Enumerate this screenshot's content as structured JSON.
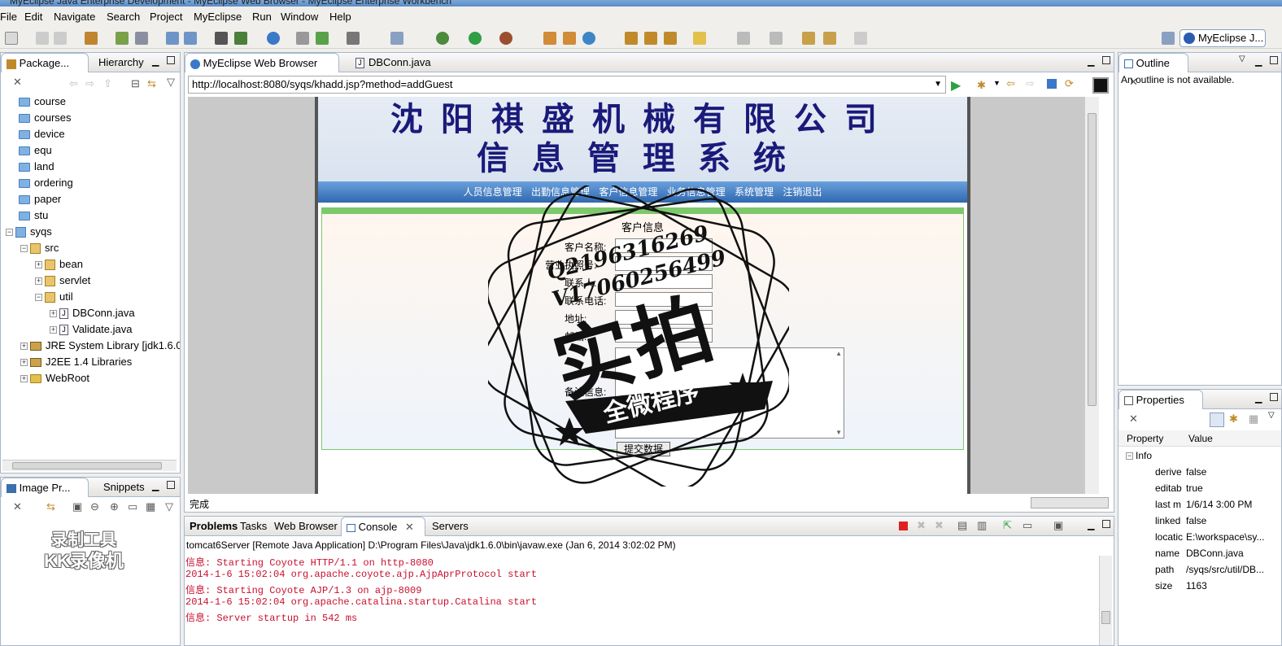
{
  "window": {
    "title": "MyEclipse Java Enterprise Development - MyEclipse Web Browser - MyEclipse Enterprise Workbench"
  },
  "menu": [
    "File",
    "Edit",
    "Navigate",
    "Search",
    "Project",
    "MyEclipse",
    "Run",
    "Window",
    "Help"
  ],
  "perspective": {
    "label": "MyEclipse J..."
  },
  "left_panel": {
    "tabs": [
      "Package...",
      "Hierarchy"
    ],
    "tree": [
      {
        "label": "course",
        "indent": 0,
        "kind": "folder"
      },
      {
        "label": "courses",
        "indent": 0,
        "kind": "folder"
      },
      {
        "label": "device",
        "indent": 0,
        "kind": "folder"
      },
      {
        "label": "equ",
        "indent": 0,
        "kind": "folder"
      },
      {
        "label": "land",
        "indent": 0,
        "kind": "folder"
      },
      {
        "label": "ordering",
        "indent": 0,
        "kind": "folder"
      },
      {
        "label": "paper",
        "indent": 0,
        "kind": "folder"
      },
      {
        "label": "stu",
        "indent": 0,
        "kind": "folder"
      },
      {
        "label": "syqs",
        "indent": 0,
        "kind": "project"
      },
      {
        "label": "src",
        "indent": 1,
        "kind": "pkg"
      },
      {
        "label": "bean",
        "indent": 2,
        "kind": "pkg"
      },
      {
        "label": "servlet",
        "indent": 2,
        "kind": "pkg"
      },
      {
        "label": "util",
        "indent": 2,
        "kind": "pkg"
      },
      {
        "label": "DBConn.java",
        "indent": 3,
        "kind": "java"
      },
      {
        "label": "Validate.java",
        "indent": 3,
        "kind": "java"
      },
      {
        "label": "JRE System Library [jdk1.6.0",
        "indent": 1,
        "kind": "lib"
      },
      {
        "label": "J2EE 1.4 Libraries",
        "indent": 1,
        "kind": "lib"
      },
      {
        "label": "WebRoot",
        "indent": 1,
        "kind": "folder"
      }
    ]
  },
  "image_panel": {
    "tabs": [
      "Image Pr...",
      "Snippets"
    ],
    "watermark": [
      "录制工具",
      "KK录像机"
    ]
  },
  "editor": {
    "tabs": [
      "MyEclipse Web Browser",
      "DBConn.java"
    ],
    "url": "http://localhost:8080/syqs/khadd.jsp?method=addGuest",
    "status": "完成"
  },
  "web": {
    "title_line1": "沈阳祺盛机械有限公司",
    "title_line2": "信息管理系统",
    "nav": [
      "人员信息管理",
      "出勤信息管理",
      "客户信息管理",
      "业务信息管理",
      "系统管理",
      "注销退出"
    ],
    "form_title": "客户信息",
    "labels": [
      "客户名称:",
      "营业执照号:",
      "联系人:",
      "联系电话:",
      "地址:",
      "邮编:",
      "备注信息:"
    ],
    "submit": "提交数据"
  },
  "stamp": {
    "qq": "Q2196316269",
    "v": "V17060256499",
    "big": "实拍",
    "banner": "全微程序"
  },
  "outline": {
    "tab": "Outline",
    "message": "An outline is not available."
  },
  "properties": {
    "tab": "Properties",
    "col_property": "Property",
    "col_value": "Value",
    "group": "Info",
    "rows": [
      {
        "k": "derive",
        "v": "false"
      },
      {
        "k": "editab",
        "v": "true"
      },
      {
        "k": "last m",
        "v": "1/6/14 3:00 PM"
      },
      {
        "k": "linked",
        "v": "false"
      },
      {
        "k": "locatic",
        "v": "E:\\workspace\\sy..."
      },
      {
        "k": "name",
        "v": "DBConn.java"
      },
      {
        "k": "path",
        "v": "/syqs/src/util/DB..."
      },
      {
        "k": "size",
        "v": "1163"
      }
    ]
  },
  "bottom": {
    "tabs": [
      "Problems",
      "Tasks",
      "Web Browser",
      "Console",
      "Servers"
    ],
    "server_line": "tomcat6Server [Remote Java Application] D:\\Program Files\\Java\\jdk1.6.0\\bin\\javaw.exe (Jan 6, 2014 3:02:02 PM)",
    "lines": [
      "信息: Starting Coyote HTTP/1.1 on http-8080",
      "2014-1-6 15:02:04 org.apache.coyote.ajp.AjpAprProtocol start",
      "信息: Starting Coyote AJP/1.3 on ajp-8009",
      "2014-1-6 15:02:04 org.apache.catalina.startup.Catalina start",
      "信息: Server startup in 542 ms"
    ]
  },
  "colors": {
    "accent": "#2a5db0",
    "console_text": "#c8102e",
    "web_title": "#1a1a7a",
    "navbar": "#3b78c4"
  }
}
